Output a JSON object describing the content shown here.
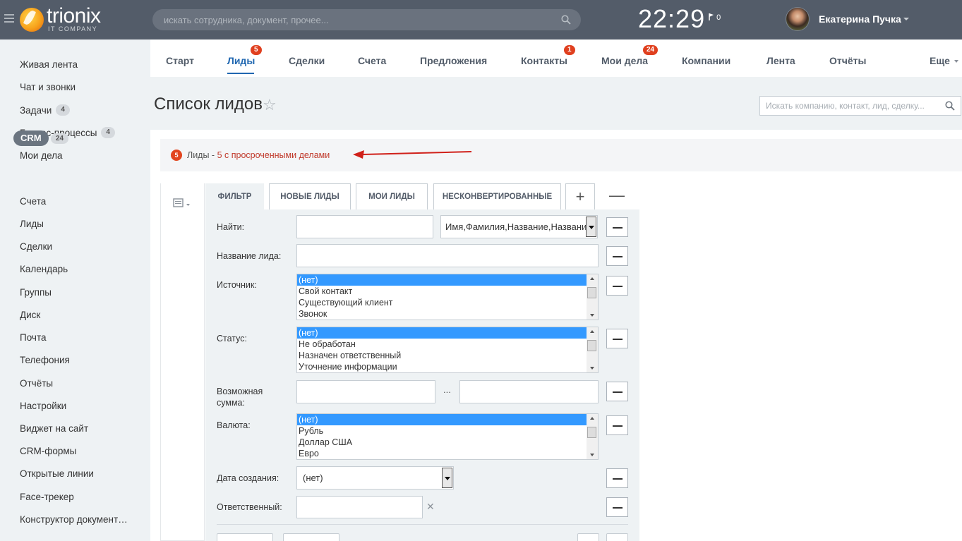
{
  "header": {
    "logo_name": "trionix",
    "logo_sub": "IT COMPANY",
    "search_placeholder": "искать сотрудника, документ, прочее...",
    "clock": "22:29",
    "flag_count": "0",
    "user_name": "Екатерина Пучка"
  },
  "sidebar": {
    "items": [
      {
        "label": "Живая лента"
      },
      {
        "label": "Чат и звонки"
      },
      {
        "label": "Задачи",
        "badge": "4"
      },
      {
        "label": "Бизнес-процессы",
        "badge": "4"
      },
      {
        "label": "Мои дела"
      },
      {
        "label": "CRM",
        "badge": "24"
      },
      {
        "label": "Счета"
      },
      {
        "label": "Лиды"
      },
      {
        "label": "Сделки"
      },
      {
        "label": "Календарь"
      },
      {
        "label": "Группы"
      },
      {
        "label": "Диск"
      },
      {
        "label": "Почта"
      },
      {
        "label": "Телефония"
      },
      {
        "label": "Отчёты"
      },
      {
        "label": "Настройки"
      },
      {
        "label": "Виджет на сайт"
      },
      {
        "label": "CRM-формы"
      },
      {
        "label": "Открытые линии"
      },
      {
        "label": "Face-трекер"
      },
      {
        "label": "Конструктор документ…"
      }
    ]
  },
  "topnav": {
    "items": [
      {
        "label": "Старт"
      },
      {
        "label": "Лиды",
        "badge": "5"
      },
      {
        "label": "Сделки"
      },
      {
        "label": "Счета"
      },
      {
        "label": "Предложения"
      },
      {
        "label": "Контакты",
        "badge": "1"
      },
      {
        "label": "Мои дела",
        "badge": "24"
      },
      {
        "label": "Компании"
      },
      {
        "label": "Лента"
      },
      {
        "label": "Отчёты"
      },
      {
        "label": "Еще"
      }
    ]
  },
  "page": {
    "title": "Список лидов",
    "star": "☆",
    "search_placeholder": "Искать компанию, контакт, лид, сделку..."
  },
  "alert": {
    "count": "5",
    "text": "Лиды - ",
    "highlight": "5 с просроченными делами"
  },
  "filter": {
    "tabs": [
      "ФИЛЬТР",
      "НОВЫЕ ЛИДЫ",
      "МОИ ЛИДЫ",
      "НЕСКОНВЕРТИРОВАННЫЕ"
    ],
    "plus": "+",
    "minus": "—",
    "find_label": "Найти:",
    "find_value": "",
    "find_fields": "Имя,Фамилия,Название,Название",
    "lead_name_label": "Название лида:",
    "source_label": "Источник:",
    "source_options": [
      "(нет)",
      "Свой контакт",
      "Существующий клиент",
      "Звонок"
    ],
    "status_label": "Статус:",
    "status_options": [
      "(нет)",
      "Не обработан",
      "Назначен ответственный",
      "Уточнение информации"
    ],
    "amount_label": "Возможная сумма:",
    "amount_sep": "...",
    "currency_label": "Валюта:",
    "currency_options": [
      "(нет)",
      "Рубль",
      "Доллар США",
      "Евро"
    ],
    "created_label": "Дата создания:",
    "created_value": "(нет)",
    "responsible_label": "Ответственный:",
    "clear": "✕"
  },
  "colors": {
    "header_bg": "#535c69",
    "accent": "#2067b0",
    "badge": "#e0401f",
    "highlight_text": "#c0392b"
  }
}
